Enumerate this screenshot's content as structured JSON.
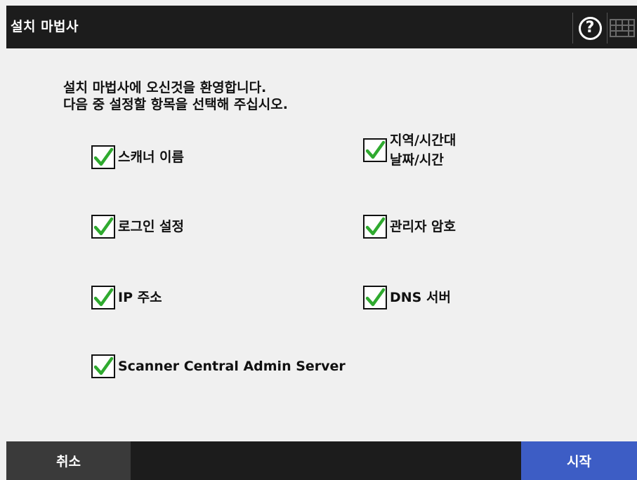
{
  "header": {
    "title": "설치 마법사",
    "help_icon": "help-icon",
    "keyboard_icon": "keyboard-icon",
    "help_glyph": "?"
  },
  "intro": {
    "line1": "설치 마법사에 오신것을 환영합니다.",
    "line2": "다음 중 설정할 항목을 선택해 주십시오."
  },
  "options": {
    "scanner_name": {
      "label": "스캐너 이름",
      "checked": true
    },
    "region_datetime": {
      "line1": "지역/시간대",
      "line2": "날짜/시간",
      "checked": true
    },
    "login_settings": {
      "label": "로그인 설정",
      "checked": true
    },
    "admin_password": {
      "label": "관리자 암호",
      "checked": true
    },
    "ip_address": {
      "label": "IP 주소",
      "checked": true
    },
    "dns_server": {
      "label": "DNS 서버",
      "checked": true
    },
    "central_admin": {
      "label": "Scanner Central Admin Server",
      "checked": true
    }
  },
  "footer": {
    "cancel_label": "취소",
    "start_label": "시작"
  },
  "colors": {
    "title_bg": "#1c1c1c",
    "start_bg": "#3d5dc5",
    "check_green": "#2faa2f"
  }
}
